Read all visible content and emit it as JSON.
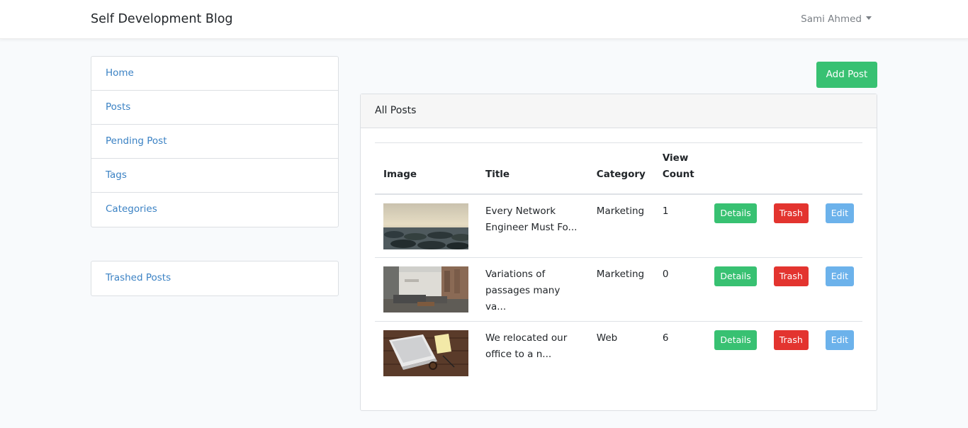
{
  "navbar": {
    "brand": "Self Development Blog",
    "user": "Sami Ahmed"
  },
  "sidebar": {
    "items": [
      {
        "label": "Home"
      },
      {
        "label": "Posts"
      },
      {
        "label": "Pending Post"
      },
      {
        "label": "Tags"
      },
      {
        "label": "Categories"
      }
    ],
    "secondary_items": [
      {
        "label": "Trashed Posts"
      }
    ]
  },
  "main": {
    "add_post_label": "Add Post",
    "card_title": "All Posts",
    "table": {
      "headers": [
        "Image",
        "Title",
        "Category",
        "View Count"
      ],
      "rows": [
        {
          "title": "Every Network Engineer Must Fo...",
          "category": "Marketing",
          "views": "1",
          "details": "Details",
          "trash": "Trash",
          "edit": "Edit"
        },
        {
          "title": "Variations of passages many va...",
          "category": "Marketing",
          "views": "0",
          "details": "Details",
          "trash": "Trash",
          "edit": "Edit"
        },
        {
          "title": "We relocated our office to a n...",
          "category": "Web",
          "views": "6",
          "details": "Details",
          "trash": "Trash",
          "edit": "Edit"
        }
      ]
    }
  },
  "colors": {
    "success": "#38c172",
    "danger": "#e3342f",
    "info": "#6cb2eb",
    "link": "#3b82c4"
  }
}
